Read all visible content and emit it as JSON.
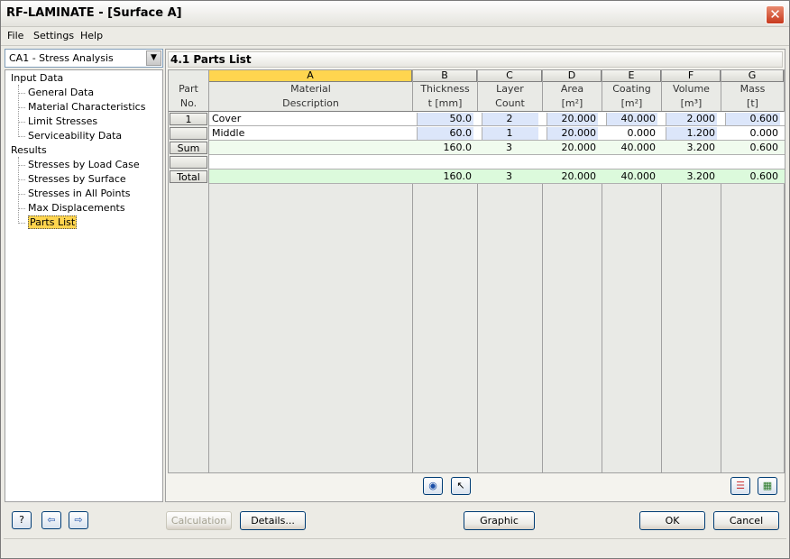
{
  "window": {
    "title": "RF-LAMINATE - [Surface A]"
  },
  "menu": [
    "File",
    "Settings",
    "Help"
  ],
  "case_selector": {
    "value": "CA1 - Stress Analysis"
  },
  "tree": {
    "groups": [
      {
        "label": "Input Data",
        "items": [
          "General Data",
          "Material Characteristics",
          "Limit Stresses",
          "Serviceability Data"
        ]
      },
      {
        "label": "Results",
        "items": [
          "Stresses by Load Case",
          "Stresses by Surface",
          "Stresses in All Points",
          "Max Displacements",
          "Parts List"
        ]
      }
    ],
    "selected": "Parts List"
  },
  "panel": {
    "title": "4.1 Parts List"
  },
  "table": {
    "col_letters": [
      "A",
      "B",
      "C",
      "D",
      "E",
      "F",
      "G"
    ],
    "rowhdr_label1": "Part",
    "rowhdr_label2": "No.",
    "headers1": [
      "Material",
      "Thickness",
      "Layer",
      "Area",
      "Coating",
      "Volume",
      "Mass"
    ],
    "headers2": [
      "Description",
      "t [mm]",
      "Count",
      "[m²]",
      "[m²]",
      "[m³]",
      "[t]"
    ],
    "rows": [
      {
        "no": "1",
        "cells": [
          "Cover",
          "50.0",
          "2",
          "20.000",
          "40.000",
          "2.000",
          "0.600"
        ]
      },
      {
        "no": "",
        "cells": [
          "Middle",
          "60.0",
          "1",
          "20.000",
          "0.000",
          "1.200",
          "0.000"
        ]
      },
      {
        "no": "Sum",
        "cells": [
          "",
          "160.0",
          "3",
          "20.000",
          "40.000",
          "3.200",
          "0.600"
        ]
      },
      {
        "no": "",
        "cells": [
          "",
          "",
          "",
          "",
          "",
          "",
          ""
        ]
      },
      {
        "no": "Total",
        "cells": [
          "",
          "160.0",
          "3",
          "20.000",
          "40.000",
          "3.200",
          "0.600"
        ]
      }
    ]
  },
  "buttons": {
    "calculation": "Calculation",
    "details": "Details...",
    "graphic": "Graphic",
    "ok": "OK",
    "cancel": "Cancel"
  },
  "colors": {
    "selected_col": "#ffd54f",
    "sum_row": "#f0fbee",
    "total_row": "#dcfadc",
    "input_cell": "#dce6fa"
  }
}
